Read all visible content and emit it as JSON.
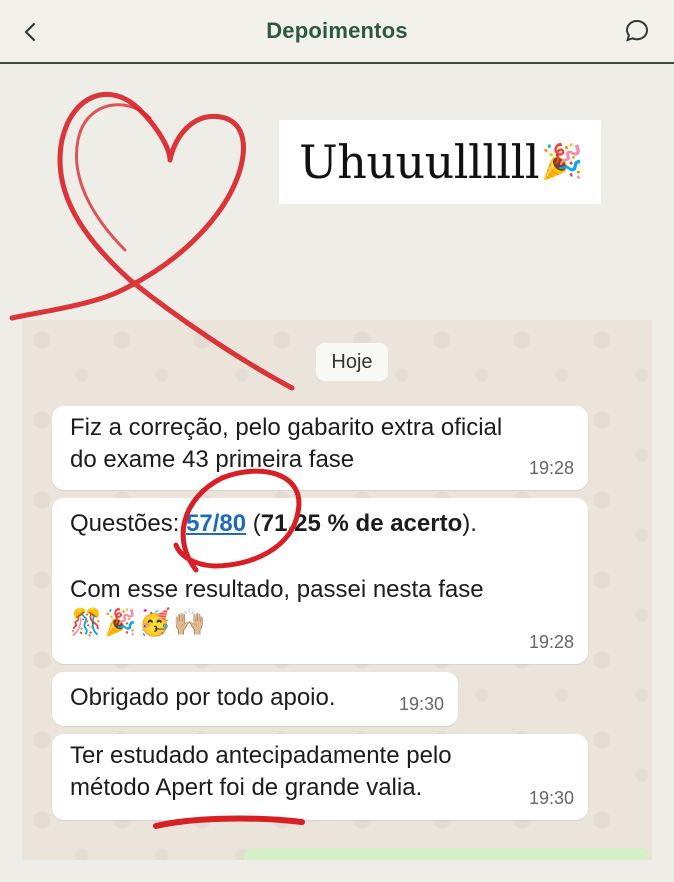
{
  "header": {
    "title": "Depoimentos",
    "back_icon": "chevron-left-icon",
    "comment_icon": "speech-bubble-icon",
    "accent_color": "#2d5a3f"
  },
  "image": {
    "headline": "Uhuuullllll",
    "headline_emoji": "🎉",
    "chat": {
      "date_label": "Hoje",
      "messages": [
        {
          "line1": "Fiz a correção, pelo gabarito extra oficial",
          "line2": "do exame 43 primeira fase",
          "time": "19:28"
        },
        {
          "prefix": "Questões: ",
          "score": "57/80",
          "middle": " (",
          "percent": "71,25 % de acerto",
          "suffix": ").",
          "line2": "Com esse resultado, passei nesta fase",
          "emojis": "🎊🎉🥳🙌🏼",
          "time": "19:28"
        },
        {
          "line1": "Obrigado por todo apoio.",
          "time": "19:30"
        },
        {
          "line1": "Ter estudado antecipadamente pelo",
          "line2": "método Apert foi de grande valia.",
          "time": "19:30"
        }
      ]
    },
    "annotation_color": "#d81f26"
  }
}
